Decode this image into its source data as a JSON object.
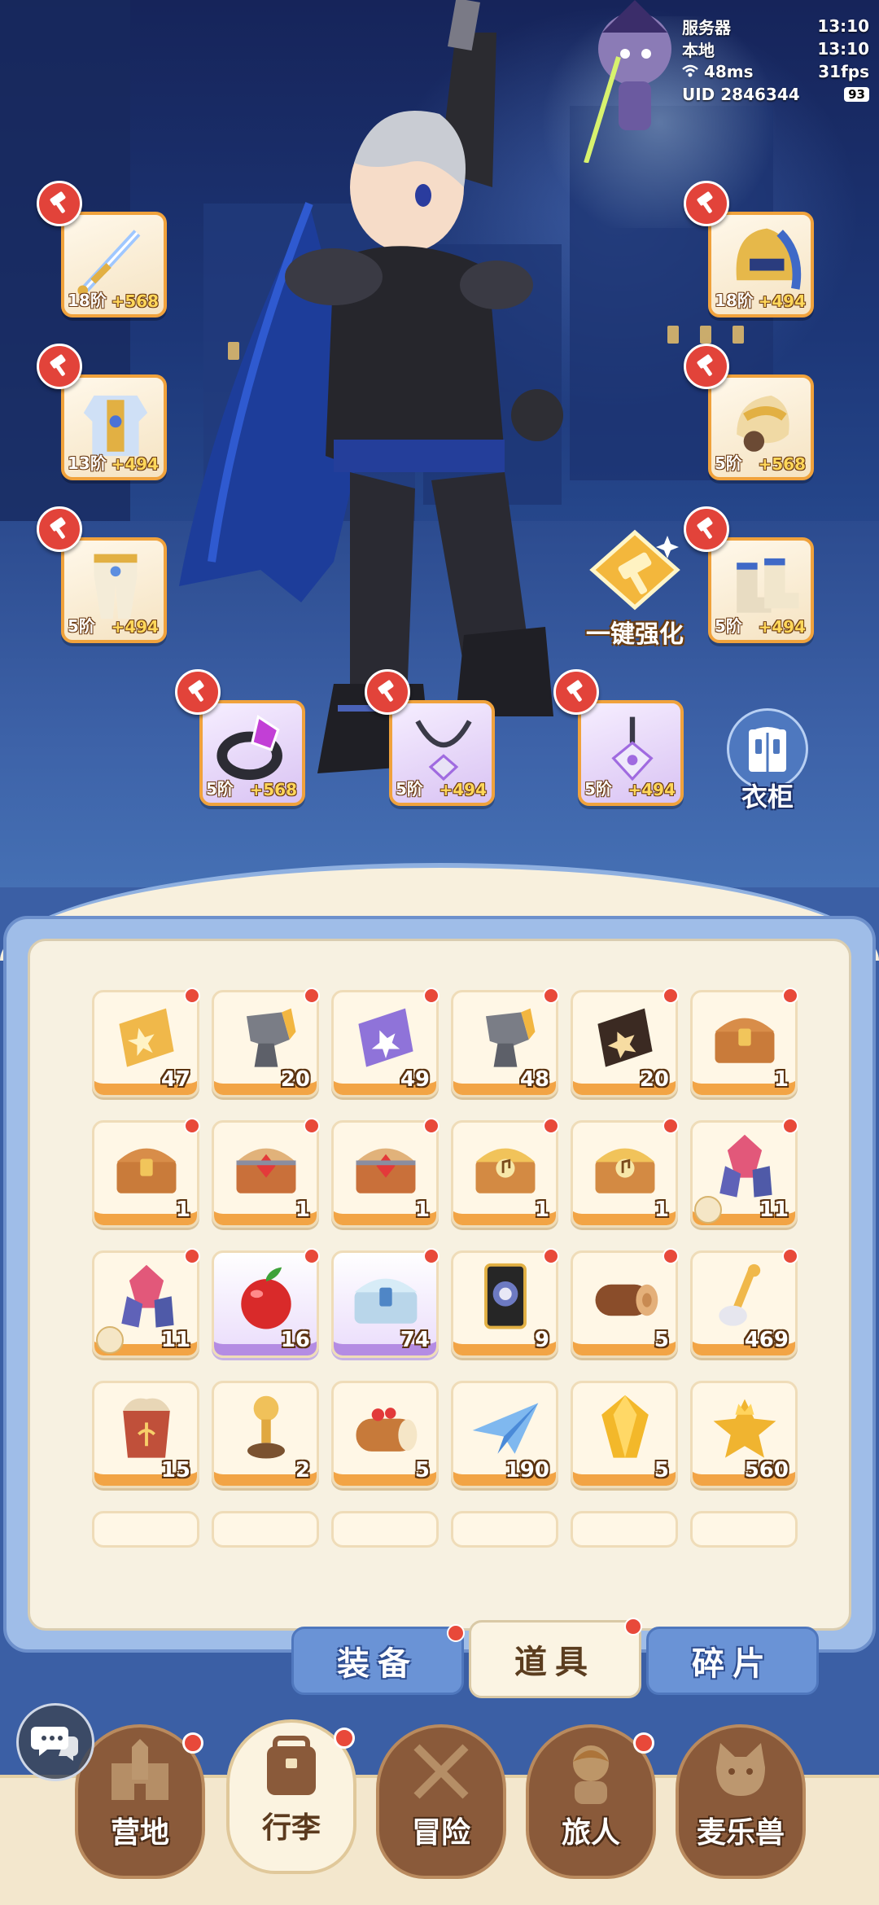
{
  "status": {
    "server_label": "服务器",
    "server_time": "13:10",
    "local_label": "本地",
    "local_time": "13:10",
    "ping": "48ms",
    "fps": "31fps",
    "uid": "UID 2846344",
    "battery": "93"
  },
  "equipment": [
    {
      "id": "weapon",
      "tier": "18阶",
      "bonus": "+568",
      "icon": "sword-icon",
      "rarity": "normal"
    },
    {
      "id": "helmet",
      "tier": "18阶",
      "bonus": "+494",
      "icon": "helmet-icon",
      "rarity": "normal"
    },
    {
      "id": "armor",
      "tier": "13阶",
      "bonus": "+494",
      "icon": "armor-icon",
      "rarity": "normal"
    },
    {
      "id": "gauntlet",
      "tier": "5阶",
      "bonus": "+568",
      "icon": "gauntlet-icon",
      "rarity": "normal"
    },
    {
      "id": "pants",
      "tier": "5阶",
      "bonus": "+494",
      "icon": "pants-icon",
      "rarity": "normal"
    },
    {
      "id": "boots",
      "tier": "5阶",
      "bonus": "+494",
      "icon": "boots-icon",
      "rarity": "normal"
    },
    {
      "id": "ring",
      "tier": "5阶",
      "bonus": "+568",
      "icon": "ring-icon",
      "rarity": "purple"
    },
    {
      "id": "necklace",
      "tier": "5阶",
      "bonus": "+494",
      "icon": "necklace-icon",
      "rarity": "purple"
    },
    {
      "id": "earring",
      "tier": "5阶",
      "bonus": "+494",
      "icon": "earring-icon",
      "rarity": "purple"
    }
  ],
  "actions": {
    "upgrade_all": "一键强化",
    "wardrobe": "衣柜"
  },
  "inventory": [
    {
      "icon": "gold-card-icon",
      "count": "47",
      "rare": false
    },
    {
      "icon": "gray-stone-icon",
      "count": "20",
      "rare": false
    },
    {
      "icon": "purple-card-icon",
      "count": "49",
      "rare": false
    },
    {
      "icon": "gray-stone-icon",
      "count": "48",
      "rare": false
    },
    {
      "icon": "dark-card-icon",
      "count": "20",
      "rare": false
    },
    {
      "icon": "treasure-chest-icon",
      "count": "1",
      "rare": false
    },
    {
      "icon": "treasure-chest-icon",
      "count": "1",
      "rare": false
    },
    {
      "icon": "red-chest-icon",
      "count": "1",
      "rare": false
    },
    {
      "icon": "red-chest-icon",
      "count": "1",
      "rare": false
    },
    {
      "icon": "music-chest-icon",
      "count": "1",
      "rare": false
    },
    {
      "icon": "music-chest-icon",
      "count": "1",
      "rare": false
    },
    {
      "icon": "crystal-icon",
      "count": "11",
      "rare": false
    },
    {
      "icon": "crystal-icon",
      "count": "11",
      "rare": false
    },
    {
      "icon": "apple-icon",
      "count": "16",
      "rare": true
    },
    {
      "icon": "blue-chest-icon",
      "count": "74",
      "rare": true
    },
    {
      "icon": "black-card-icon",
      "count": "9",
      "rare": false
    },
    {
      "icon": "log-icon",
      "count": "5",
      "rare": false
    },
    {
      "icon": "spoon-icon",
      "count": "469",
      "rare": false
    },
    {
      "icon": "seed-bag-icon",
      "count": "15",
      "rare": false
    },
    {
      "icon": "paw-stamp-icon",
      "count": "2",
      "rare": false
    },
    {
      "icon": "cake-roll-icon",
      "count": "5",
      "rare": false
    },
    {
      "icon": "paper-plane-icon",
      "count": "190",
      "rare": false
    },
    {
      "icon": "gold-gem-icon",
      "count": "5",
      "rare": false
    },
    {
      "icon": "cat-coin-icon",
      "count": "560",
      "rare": false
    }
  ],
  "tabs": [
    {
      "label": "装备",
      "active": false,
      "dot": true
    },
    {
      "label": "道具",
      "active": true,
      "dot": true
    },
    {
      "label": "碎片",
      "active": false,
      "dot": false
    }
  ],
  "nav": [
    {
      "label": "营地",
      "icon": "castle-icon",
      "active": false,
      "dot": true
    },
    {
      "label": "行李",
      "icon": "backpack-icon",
      "active": true,
      "dot": true
    },
    {
      "label": "冒险",
      "icon": "crossed-swords-icon",
      "active": false,
      "dot": false
    },
    {
      "label": "旅人",
      "icon": "traveler-icon",
      "active": false,
      "dot": true
    },
    {
      "label": "麦乐兽",
      "icon": "cat-pet-icon",
      "active": false,
      "dot": false
    }
  ]
}
